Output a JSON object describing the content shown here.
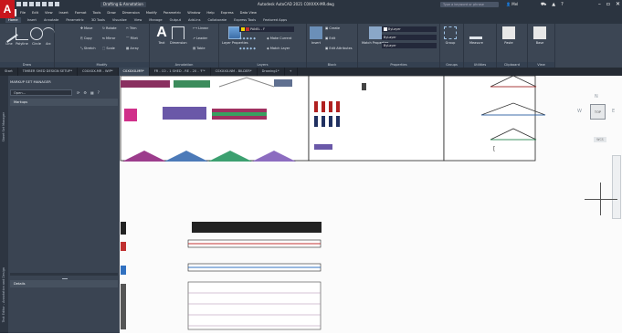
{
  "app": {
    "logo": "A",
    "workspace": "Drafting & Annotation",
    "title": "Autodesk AutoCAD 2021   C0XXXX-MR.dwg",
    "search_placeholder": "Type a keyword or phrase",
    "user": "Mel",
    "colors": {
      "chrome": "#2b3440",
      "ribbon": "#3c4654",
      "logo": "#c8161d",
      "canvas": "#fbfbfb"
    }
  },
  "menubar": [
    "File",
    "Edit",
    "View",
    "Insert",
    "Format",
    "Tools",
    "Draw",
    "Dimension",
    "Modify",
    "Parametric",
    "Window",
    "Help",
    "Express",
    "Data View"
  ],
  "ribbon_tabs": [
    {
      "label": "Home",
      "active": true
    },
    {
      "label": "Insert"
    },
    {
      "label": "Annotate"
    },
    {
      "label": "Parametric"
    },
    {
      "label": "3D Tools"
    },
    {
      "label": "Visualize"
    },
    {
      "label": "View"
    },
    {
      "label": "Manage"
    },
    {
      "label": "Output"
    },
    {
      "label": "Add-ins"
    },
    {
      "label": "Collaborate"
    },
    {
      "label": "Express Tools"
    },
    {
      "label": "Featured Apps"
    }
  ],
  "ribbon": {
    "draw": {
      "title": "Draw",
      "line": "Line",
      "polyline": "Polyline",
      "circle": "Circle",
      "arc": "Arc"
    },
    "modify": {
      "title": "Modify",
      "move": "Move",
      "rotate": "Rotate",
      "trim": "Trim",
      "copy": "Copy",
      "mirror": "Mirror",
      "fillet": "Fillet",
      "stretch": "Stretch",
      "scale": "Scale",
      "array": "Array"
    },
    "annotation": {
      "title": "Annotation",
      "text": "Text",
      "dimension": "Dimension",
      "linear": "Linear",
      "leader": "Leader",
      "table": "Table"
    },
    "layers": {
      "title": "Layers",
      "properties": "Layer Properties",
      "current_layer": "PANEL - F",
      "make_current": "Make Current",
      "match_layer": "Match Layer"
    },
    "block": {
      "title": "Block",
      "insert": "Insert",
      "create": "Create",
      "edit": "Edit",
      "edit_attributes": "Edit Attributes"
    },
    "properties": {
      "title": "Properties",
      "match": "Match Properties",
      "bylayer1": "ByLayer",
      "bylayer2": "ByLayer",
      "bylayer3": "ByLayer"
    },
    "groups": {
      "title": "Groups",
      "group": "Group"
    },
    "utilities": {
      "title": "Utilities",
      "measure": "Measure"
    },
    "clipboard": {
      "title": "Clipboard",
      "paste": "Paste"
    },
    "view": {
      "title": "View",
      "base": "Base"
    }
  },
  "doc_tabs": [
    {
      "label": "Start"
    },
    {
      "label": "TIMBER SHED DESIGN SETUP*"
    },
    {
      "label": "C0XXXX-MR - WIP*"
    },
    {
      "label": "C0XXXX-MR*",
      "active": true
    },
    {
      "label": "FR - C0 - 1 SHED - RE - 20 - 'F'*"
    },
    {
      "label": "C0XXXX-NM - BILDER*"
    },
    {
      "label": "Drawing1*"
    }
  ],
  "sheet_set_manager": {
    "header": "MARKUP SET MANAGER",
    "open_label": "Open...",
    "markups_label": "Markups",
    "details_label": "Details",
    "strip_title_top": "Sheet Set Manager",
    "strip_title_bottom": "Text Editor - Annotation and Design"
  },
  "viewcube": {
    "top": "TOP",
    "n": "N",
    "w": "W",
    "e": "E",
    "wcs": "WCS"
  }
}
